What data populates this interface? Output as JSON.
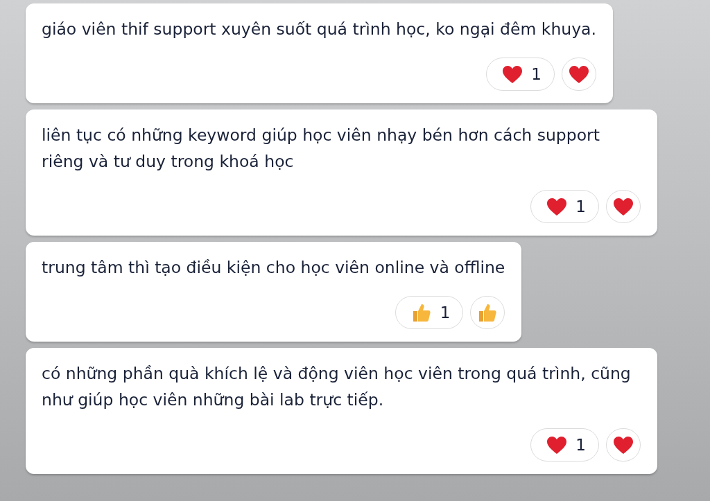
{
  "messages": [
    {
      "text": "giáo viên thif support xuyên suốt quá trình học, ko ngại đêm khuya.",
      "reaction": {
        "kind": "heart",
        "count": "1"
      }
    },
    {
      "text": "liên tục có những keyword giúp học viên nhạy bén hơn cách support riêng và tư duy trong khoá học",
      "reaction": {
        "kind": "heart",
        "count": "1"
      }
    },
    {
      "text": "trung tâm thì tạo điều kiện cho học viên online và offline",
      "reaction": {
        "kind": "thumbs",
        "count": "1"
      }
    },
    {
      "text": "có những phần quà khích lệ và động viên học viên trong quá trình, cũng như giúp học viên những bài lab trực tiếp.",
      "reaction": {
        "kind": "heart",
        "count": "1"
      }
    }
  ]
}
